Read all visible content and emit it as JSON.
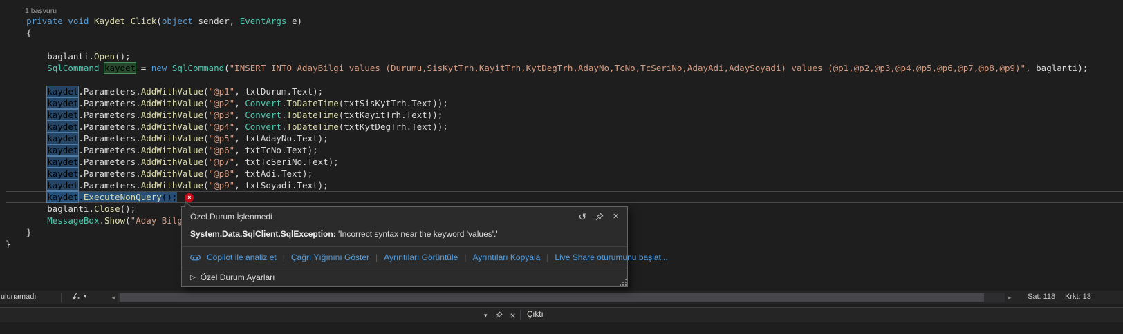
{
  "editor": {
    "error_icon": "×",
    "lines": [
      {
        "codelens": true,
        "tokens": [
          [
            "cl",
            "1 başvuru"
          ]
        ]
      },
      {
        "tokens": [
          [
            "pl",
            "    "
          ],
          [
            "kw",
            "private"
          ],
          [
            "pl",
            " "
          ],
          [
            "kw",
            "void"
          ],
          [
            "pl",
            " "
          ],
          [
            "me",
            "Kaydet_Click"
          ],
          [
            "pl",
            "("
          ],
          [
            "kw",
            "object"
          ],
          [
            "pl",
            " "
          ],
          [
            "pl",
            "sender"
          ],
          [
            "pl",
            ", "
          ],
          [
            "ty",
            "EventArgs"
          ],
          [
            "pl",
            " "
          ],
          [
            "pl",
            "e"
          ],
          [
            "pl",
            ")"
          ]
        ]
      },
      {
        "tokens": [
          [
            "pl",
            "    {"
          ]
        ]
      },
      {
        "tokens": []
      },
      {
        "tokens": [
          [
            "pl",
            "        "
          ],
          [
            "pl",
            "baglanti"
          ],
          [
            "pl",
            "."
          ],
          [
            "me",
            "Open"
          ],
          [
            "pl",
            "();"
          ]
        ]
      },
      {
        "tokens": [
          [
            "pl",
            "        "
          ],
          [
            "ty",
            "SqlCommand"
          ],
          [
            "pl",
            " "
          ],
          [
            "def",
            "kaydet"
          ],
          [
            "pl",
            " = "
          ],
          [
            "kw",
            "new"
          ],
          [
            "pl",
            " "
          ],
          [
            "ty",
            "SqlCommand"
          ],
          [
            "pl",
            "("
          ],
          [
            "st",
            "\"INSERT INTO AdayBilgi values (Durumu,SisKytTrh,KayitTrh,KytDegTrh,AdayNo,TcNo,TcSeriNo,AdayAdi,AdaySoyadi) values (@p1,@p2,@p3,@p4,@p5,@p6,@p7,@p8,@p9)\""
          ],
          [
            "pl",
            ", "
          ],
          [
            "pl",
            "baglanti"
          ],
          [
            "pl",
            ");"
          ]
        ]
      },
      {
        "tokens": []
      },
      {
        "tokens": [
          [
            "pl",
            "        "
          ],
          [
            "ref",
            "kaydet"
          ],
          [
            "pl",
            "."
          ],
          [
            "pl",
            "Parameters"
          ],
          [
            "pl",
            "."
          ],
          [
            "me",
            "AddWithValue"
          ],
          [
            "pl",
            "("
          ],
          [
            "st",
            "\"@p1\""
          ],
          [
            "pl",
            ", "
          ],
          [
            "pl",
            "txtDurum"
          ],
          [
            "pl",
            "."
          ],
          [
            "pl",
            "Text"
          ],
          [
            "pl",
            ");"
          ]
        ]
      },
      {
        "tokens": [
          [
            "pl",
            "        "
          ],
          [
            "ref",
            "kaydet"
          ],
          [
            "pl",
            "."
          ],
          [
            "pl",
            "Parameters"
          ],
          [
            "pl",
            "."
          ],
          [
            "me",
            "AddWithValue"
          ],
          [
            "pl",
            "("
          ],
          [
            "st",
            "\"@p2\""
          ],
          [
            "pl",
            ", "
          ],
          [
            "ty",
            "Convert"
          ],
          [
            "pl",
            "."
          ],
          [
            "me",
            "ToDateTime"
          ],
          [
            "pl",
            "("
          ],
          [
            "pl",
            "txtSisKytTrh"
          ],
          [
            "pl",
            "."
          ],
          [
            "pl",
            "Text"
          ],
          [
            "pl",
            "));"
          ]
        ]
      },
      {
        "tokens": [
          [
            "pl",
            "        "
          ],
          [
            "ref",
            "kaydet"
          ],
          [
            "pl",
            "."
          ],
          [
            "pl",
            "Parameters"
          ],
          [
            "pl",
            "."
          ],
          [
            "me",
            "AddWithValue"
          ],
          [
            "pl",
            "("
          ],
          [
            "st",
            "\"@p3\""
          ],
          [
            "pl",
            ", "
          ],
          [
            "ty",
            "Convert"
          ],
          [
            "pl",
            "."
          ],
          [
            "me",
            "ToDateTime"
          ],
          [
            "pl",
            "("
          ],
          [
            "pl",
            "txtKayitTrh"
          ],
          [
            "pl",
            "."
          ],
          [
            "pl",
            "Text"
          ],
          [
            "pl",
            "));"
          ]
        ]
      },
      {
        "tokens": [
          [
            "pl",
            "        "
          ],
          [
            "ref",
            "kaydet"
          ],
          [
            "pl",
            "."
          ],
          [
            "pl",
            "Parameters"
          ],
          [
            "pl",
            "."
          ],
          [
            "me",
            "AddWithValue"
          ],
          [
            "pl",
            "("
          ],
          [
            "st",
            "\"@p4\""
          ],
          [
            "pl",
            ", "
          ],
          [
            "ty",
            "Convert"
          ],
          [
            "pl",
            "."
          ],
          [
            "me",
            "ToDateTime"
          ],
          [
            "pl",
            "("
          ],
          [
            "pl",
            "txtKytDegTrh"
          ],
          [
            "pl",
            "."
          ],
          [
            "pl",
            "Text"
          ],
          [
            "pl",
            "));"
          ]
        ]
      },
      {
        "tokens": [
          [
            "pl",
            "        "
          ],
          [
            "ref",
            "kaydet"
          ],
          [
            "pl",
            "."
          ],
          [
            "pl",
            "Parameters"
          ],
          [
            "pl",
            "."
          ],
          [
            "me",
            "AddWithValue"
          ],
          [
            "pl",
            "("
          ],
          [
            "st",
            "\"@p5\""
          ],
          [
            "pl",
            ", "
          ],
          [
            "pl",
            "txtAdayNo"
          ],
          [
            "pl",
            "."
          ],
          [
            "pl",
            "Text"
          ],
          [
            "pl",
            ");"
          ]
        ]
      },
      {
        "tokens": [
          [
            "pl",
            "        "
          ],
          [
            "ref",
            "kaydet"
          ],
          [
            "pl",
            "."
          ],
          [
            "pl",
            "Parameters"
          ],
          [
            "pl",
            "."
          ],
          [
            "me",
            "AddWithValue"
          ],
          [
            "pl",
            "("
          ],
          [
            "st",
            "\"@p6\""
          ],
          [
            "pl",
            ", "
          ],
          [
            "pl",
            "txtTcNo"
          ],
          [
            "pl",
            "."
          ],
          [
            "pl",
            "Text"
          ],
          [
            "pl",
            ");"
          ]
        ]
      },
      {
        "tokens": [
          [
            "pl",
            "        "
          ],
          [
            "ref",
            "kaydet"
          ],
          [
            "pl",
            "."
          ],
          [
            "pl",
            "Parameters"
          ],
          [
            "pl",
            "."
          ],
          [
            "me",
            "AddWithValue"
          ],
          [
            "pl",
            "("
          ],
          [
            "st",
            "\"@p7\""
          ],
          [
            "pl",
            ", "
          ],
          [
            "pl",
            "txtTcSeriNo"
          ],
          [
            "pl",
            "."
          ],
          [
            "pl",
            "Text"
          ],
          [
            "pl",
            ");"
          ]
        ]
      },
      {
        "tokens": [
          [
            "pl",
            "        "
          ],
          [
            "ref",
            "kaydet"
          ],
          [
            "pl",
            "."
          ],
          [
            "pl",
            "Parameters"
          ],
          [
            "pl",
            "."
          ],
          [
            "me",
            "AddWithValue"
          ],
          [
            "pl",
            "("
          ],
          [
            "st",
            "\"@p8\""
          ],
          [
            "pl",
            ", "
          ],
          [
            "pl",
            "txtAdi"
          ],
          [
            "pl",
            "."
          ],
          [
            "pl",
            "Text"
          ],
          [
            "pl",
            ");"
          ]
        ]
      },
      {
        "tokens": [
          [
            "pl",
            "        "
          ],
          [
            "ref",
            "kaydet"
          ],
          [
            "pl",
            "."
          ],
          [
            "pl",
            "Parameters"
          ],
          [
            "pl",
            "."
          ],
          [
            "me",
            "AddWithValue"
          ],
          [
            "pl",
            "("
          ],
          [
            "st",
            "\"@p9\""
          ],
          [
            "pl",
            ", "
          ],
          [
            "pl",
            "txtSoyadi"
          ],
          [
            "pl",
            "."
          ],
          [
            "pl",
            "Text"
          ],
          [
            "pl",
            ");"
          ]
        ]
      },
      {
        "current": true,
        "error": true,
        "tokens": [
          [
            "pl",
            "        "
          ],
          [
            "ref sel",
            "kaydet"
          ],
          [
            "sel",
            "."
          ],
          [
            "me sel",
            "ExecuteNonQuery"
          ],
          [
            "sel",
            "();"
          ]
        ]
      },
      {
        "tokens": [
          [
            "pl",
            "        "
          ],
          [
            "pl",
            "baglanti"
          ],
          [
            "pl",
            "."
          ],
          [
            "me",
            "Close"
          ],
          [
            "pl",
            "();"
          ]
        ]
      },
      {
        "tokens": [
          [
            "pl",
            "        "
          ],
          [
            "ty",
            "MessageBox"
          ],
          [
            "pl",
            "."
          ],
          [
            "me",
            "Show"
          ],
          [
            "pl",
            "("
          ],
          [
            "st",
            "\"Aday Bilg"
          ]
        ]
      },
      {
        "tokens": [
          [
            "pl",
            "    }"
          ]
        ]
      },
      {
        "tokens": [
          [
            "pl",
            "}"
          ]
        ]
      }
    ]
  },
  "popup": {
    "title": "Özel Durum İşlenmedi",
    "exception_type": "System.Data.SqlClient.SqlException:",
    "exception_detail": " 'Incorrect syntax near the keyword 'values'.'",
    "links": [
      "Copilot ile analiz et",
      "Çağrı Yığınını Göster",
      "Ayrıntıları Görüntüle",
      "Ayrıntıları Kopyala",
      "Live Share oturumunu başlat..."
    ],
    "expander_label": "Özel Durum Ayarları"
  },
  "statusbar": {
    "left_text": "ulunamadı",
    "line_label": "Sat: 118",
    "col_label": "Krkt: 13"
  },
  "output_panel": {
    "title": "Çıktı"
  },
  "icons": {
    "chevron_down": "▾",
    "expander": "▷",
    "scroll_left": "◄",
    "scroll_right": "►",
    "close": "×",
    "history": "↺",
    "sep": "|"
  },
  "colors": {
    "editor_background": "#1E1E1E",
    "selection": "#264F78",
    "link_blue": "#4F9FE6",
    "error_red": "#C50B17",
    "keyword_blue": "#569CD6",
    "type_teal": "#4EC9B0",
    "string_orange": "#D69D85"
  }
}
